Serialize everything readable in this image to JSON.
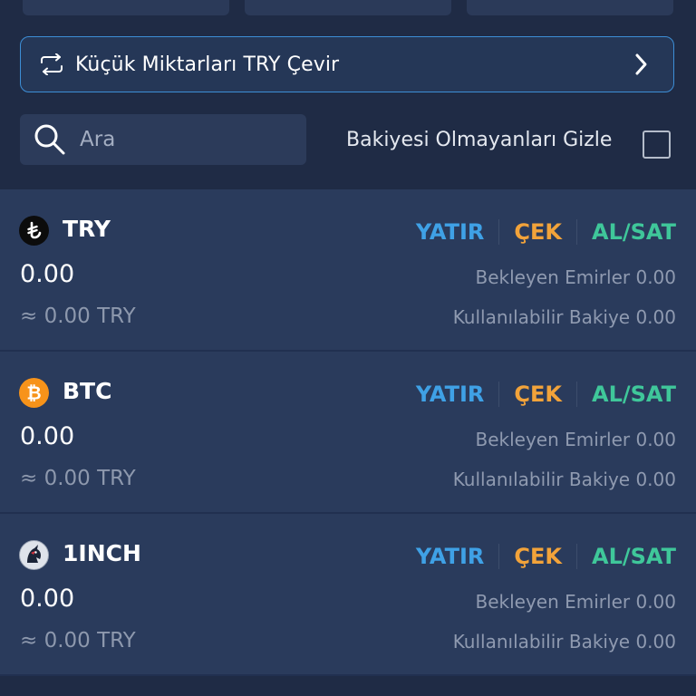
{
  "convert": {
    "label": "Küçük Miktarları TRY Çevir"
  },
  "search": {
    "placeholder": "Ara"
  },
  "filters": {
    "hide_zero_label": "Bakiyesi Olmayanları Gizle"
  },
  "actions": {
    "deposit": "YATIR",
    "withdraw": "ÇEK",
    "trade": "AL/SAT"
  },
  "colors": {
    "deposit": "#3fa1e6",
    "withdraw": "#f2a33a",
    "trade": "#3fc79a",
    "accent_border": "#3d8ed6"
  },
  "assets": [
    {
      "icon": "try-lira-icon",
      "symbol": "TRY",
      "balance": "0.00",
      "approx": "≈ 0.00 TRY",
      "pending": "Bekleyen Emirler 0.00",
      "available": "Kullanılabilir Bakiye 0.00"
    },
    {
      "icon": "bitcoin-icon",
      "symbol": "BTC",
      "balance": "0.00",
      "approx": "≈ 0.00 TRY",
      "pending": "Bekleyen Emirler 0.00",
      "available": "Kullanılabilir Bakiye 0.00"
    },
    {
      "icon": "1inch-unicorn-icon",
      "symbol": "1INCH",
      "balance": "0.00",
      "approx": "≈ 0.00 TRY",
      "pending": "Bekleyen Emirler 0.00",
      "available": "Kullanılabilir Bakiye 0.00"
    }
  ]
}
